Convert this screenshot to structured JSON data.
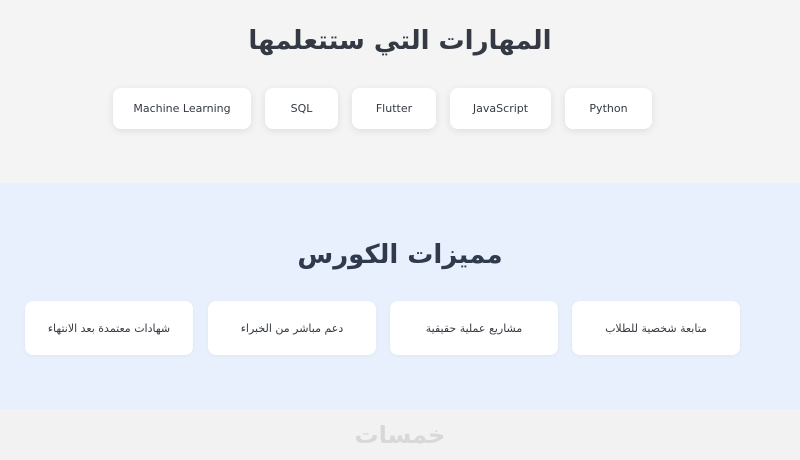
{
  "skills": {
    "title": "المهارات التي ستتعلمها",
    "items": [
      "Python",
      "JavaScript",
      "Flutter",
      "SQL",
      "Machine Learning"
    ]
  },
  "features": {
    "title": "مميزات الكورس",
    "items": [
      "متابعة شخصية للطلاب",
      "مشاريع عملية حقيقية",
      "دعم مباشر من الخبراء",
      "شهادات معتمدة بعد الانتهاء"
    ]
  },
  "footer": {
    "watermark": "خمسات"
  },
  "colors": {
    "skills_bg": "#f4f4f4",
    "features_bg": "#e8f0fd",
    "card_bg": "#ffffff",
    "heading": "#333a44"
  }
}
